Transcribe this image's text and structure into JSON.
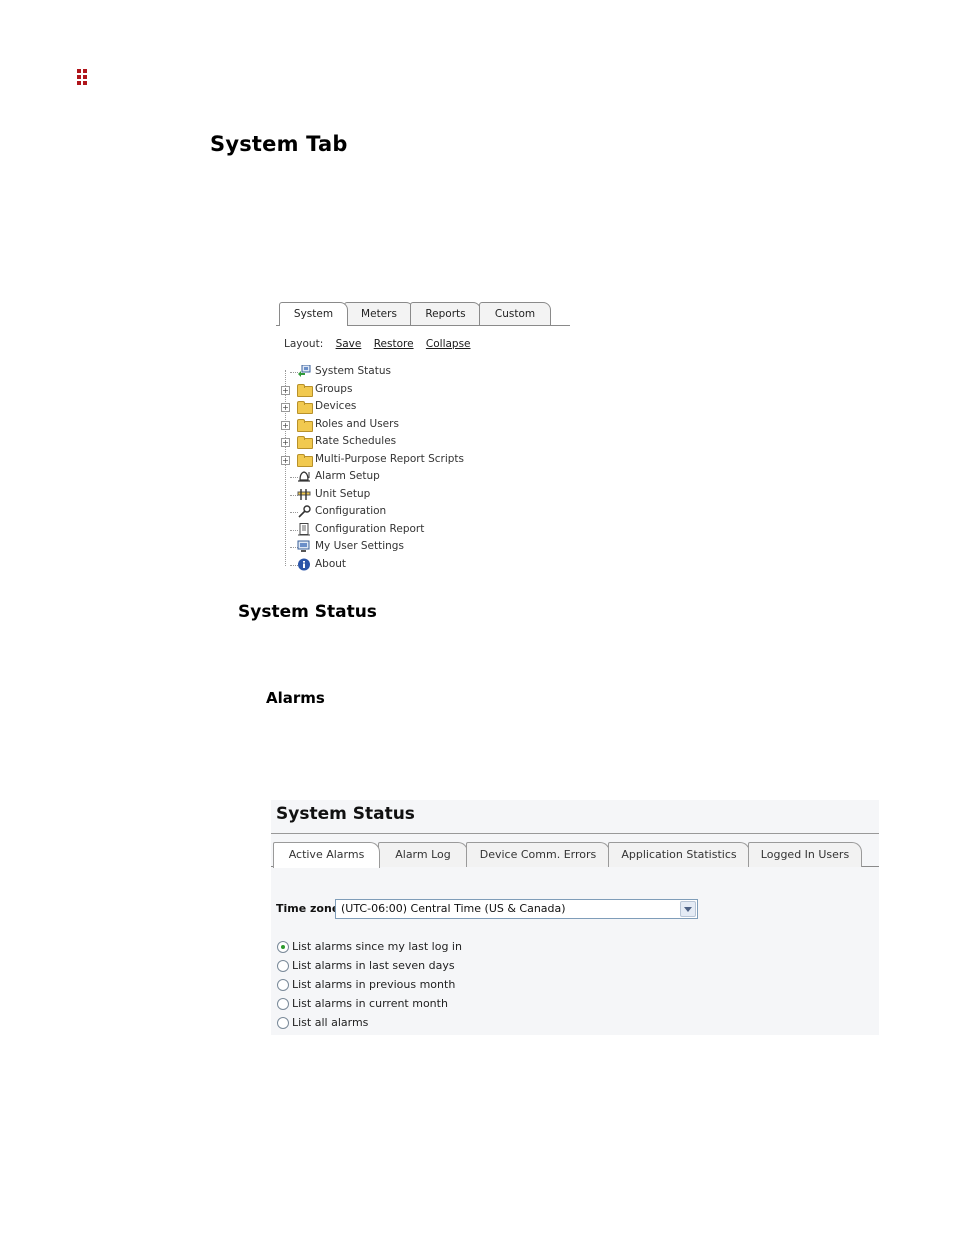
{
  "page": {
    "heading": "System Tab",
    "subheading": "System Status",
    "subsubheading": "Alarms"
  },
  "tree_panel": {
    "tabs": [
      "System",
      "Meters",
      "Reports",
      "Custom"
    ],
    "active_tab": "System",
    "layout_label": "Layout:",
    "layout_links": [
      "Save",
      "Restore",
      "Collapse"
    ],
    "items": [
      {
        "label": "System Status",
        "icon": "system-status-icon"
      },
      {
        "label": "Groups",
        "icon": "folder-icon"
      },
      {
        "label": "Devices",
        "icon": "folder-icon"
      },
      {
        "label": "Roles and Users",
        "icon": "folder-icon"
      },
      {
        "label": "Rate Schedules",
        "icon": "folder-icon"
      },
      {
        "label": "Multi-Purpose Report Scripts",
        "icon": "folder-icon"
      },
      {
        "label": "Alarm Setup",
        "icon": "alarm-icon"
      },
      {
        "label": "Unit Setup",
        "icon": "unit-icon"
      },
      {
        "label": "Configuration",
        "icon": "wrench-icon"
      },
      {
        "label": "Configuration Report",
        "icon": "report-icon"
      },
      {
        "label": "My User Settings",
        "icon": "user-settings-icon"
      },
      {
        "label": "About",
        "icon": "info-icon"
      }
    ]
  },
  "status_panel": {
    "title": "System Status",
    "tabs": [
      "Active Alarms",
      "Alarm Log",
      "Device Comm. Errors",
      "Application Statistics",
      "Logged In Users"
    ],
    "active_tab": "Active Alarms",
    "timezone_label": "Time zone",
    "timezone_value": "(UTC-06:00) Central Time (US & Canada)",
    "options": [
      "List alarms since my last log in",
      "List alarms in last seven days",
      "List alarms in previous month",
      "List alarms in current month",
      "List all alarms"
    ],
    "selected_option": 0
  },
  "colors": {
    "logo": "#b0151b",
    "folder": "#f1c94f",
    "radio_selected": "#2d9a2d"
  }
}
